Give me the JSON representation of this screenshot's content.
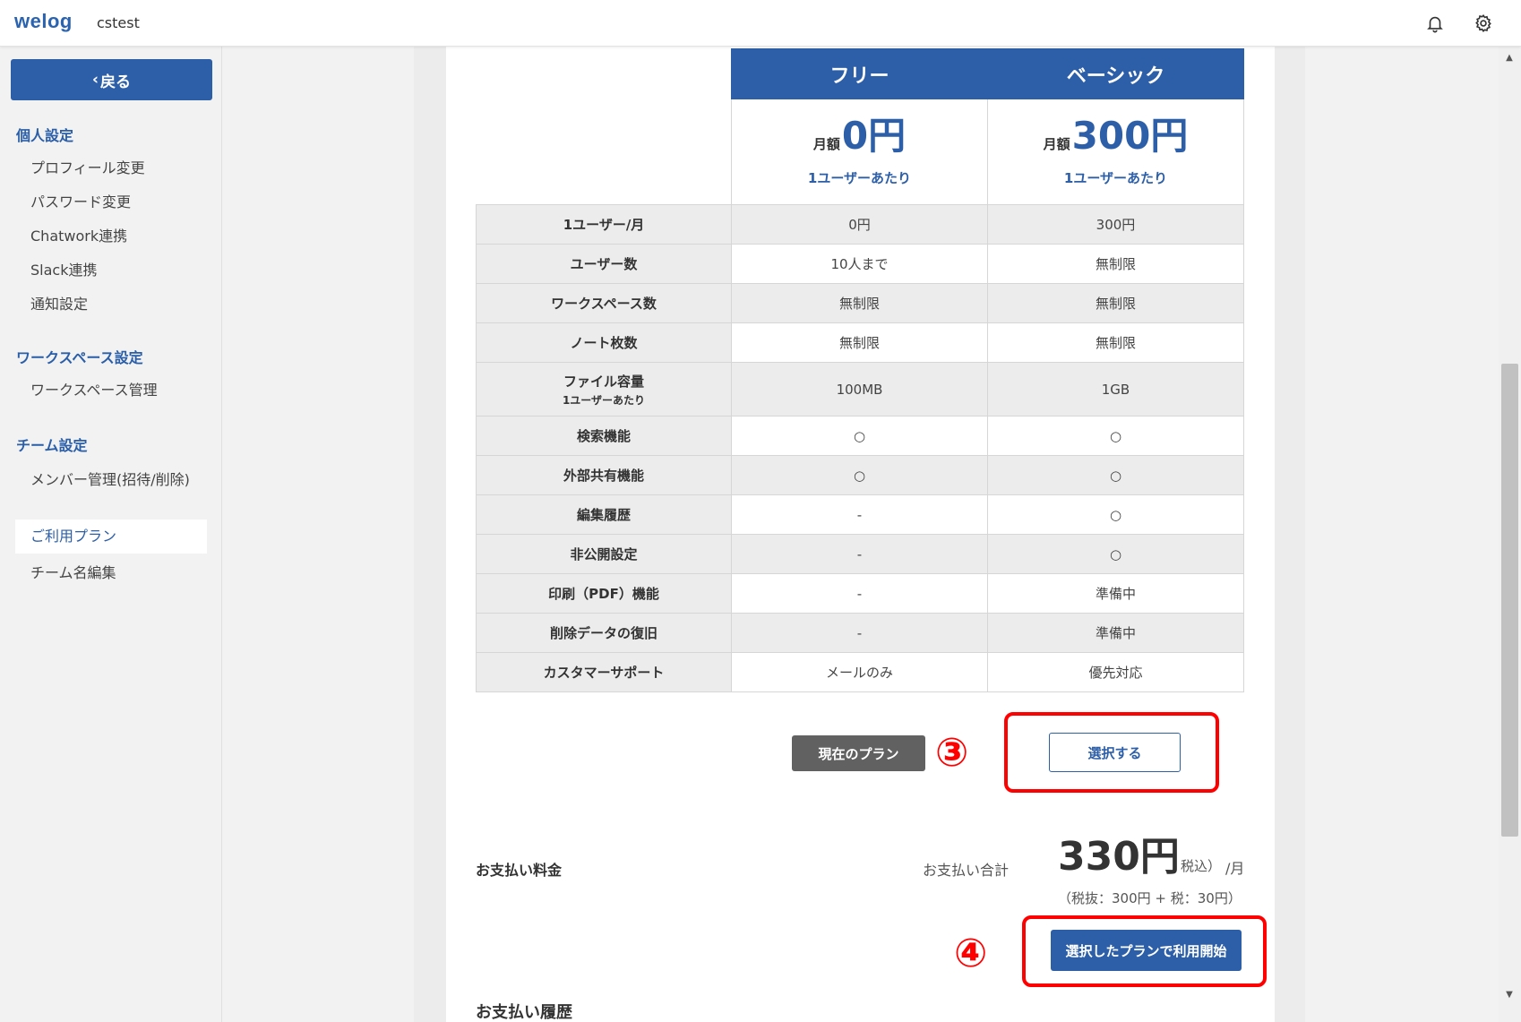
{
  "header": {
    "logo": "welog",
    "team_name": "cstest"
  },
  "sidebar": {
    "back_label": "戻る",
    "sections": [
      {
        "title": "個人設定",
        "items": [
          "プロフィール変更",
          "パスワード変更",
          "Chatwork連携",
          "Slack連携",
          "通知設定"
        ]
      },
      {
        "title": "ワークスペース設定",
        "items": [
          "ワークスペース管理"
        ]
      },
      {
        "title": "チーム設定",
        "items": [
          "メンバー管理(招待/削除)",
          "ご利用プラン",
          "チーム名編集"
        ]
      }
    ],
    "active_item": "ご利用プラン"
  },
  "plans": {
    "free": {
      "name": "フリー",
      "price_label": "月額",
      "price": "0円",
      "per_user": "1ユーザーあたり"
    },
    "basic": {
      "name": "ベーシック",
      "price_label": "月額",
      "price": "300円",
      "per_user": "1ユーザーあたり"
    }
  },
  "features": [
    {
      "label": "1ユーザー/月",
      "free": "0円",
      "basic": "300円"
    },
    {
      "label": "ユーザー数",
      "free": "10人まで",
      "basic": "無制限"
    },
    {
      "label": "ワークスペース数",
      "free": "無制限",
      "basic": "無制限"
    },
    {
      "label": "ノート枚数",
      "free": "無制限",
      "basic": "無制限"
    },
    {
      "label": "ファイル容量",
      "sub": "1ユーザーあたり",
      "free": "100MB",
      "basic": "1GB"
    },
    {
      "label": "検索機能",
      "free": "○",
      "basic": "○"
    },
    {
      "label": "外部共有機能",
      "free": "○",
      "basic": "○"
    },
    {
      "label": "編集履歴",
      "free": "-",
      "basic": "○"
    },
    {
      "label": "非公開設定",
      "free": "-",
      "basic": "○"
    },
    {
      "label": "印刷（PDF）機能",
      "free": "-",
      "basic": "準備中"
    },
    {
      "label": "削除データの復旧",
      "free": "-",
      "basic": "準備中"
    },
    {
      "label": "カスタマーサポート",
      "free": "メールのみ",
      "basic": "優先対応"
    }
  ],
  "actions": {
    "current_plan_label": "現在のプラン",
    "select_label": "選択する",
    "step3_marker": "③",
    "step4_marker": "④",
    "start_label": "選択したプランで利用開始"
  },
  "payment": {
    "label": "お支払い料金",
    "total_label": "お支払い合計",
    "amount": "330円",
    "tax_note": "税込）",
    "unit": "/月",
    "breakdown": "（税抜：300円 + 税：30円）"
  },
  "history": {
    "title": "お支払い履歴"
  },
  "colors": {
    "brand": "#2d5fa8",
    "highlight": "#ff0000",
    "current_plan_bg": "#616161"
  }
}
